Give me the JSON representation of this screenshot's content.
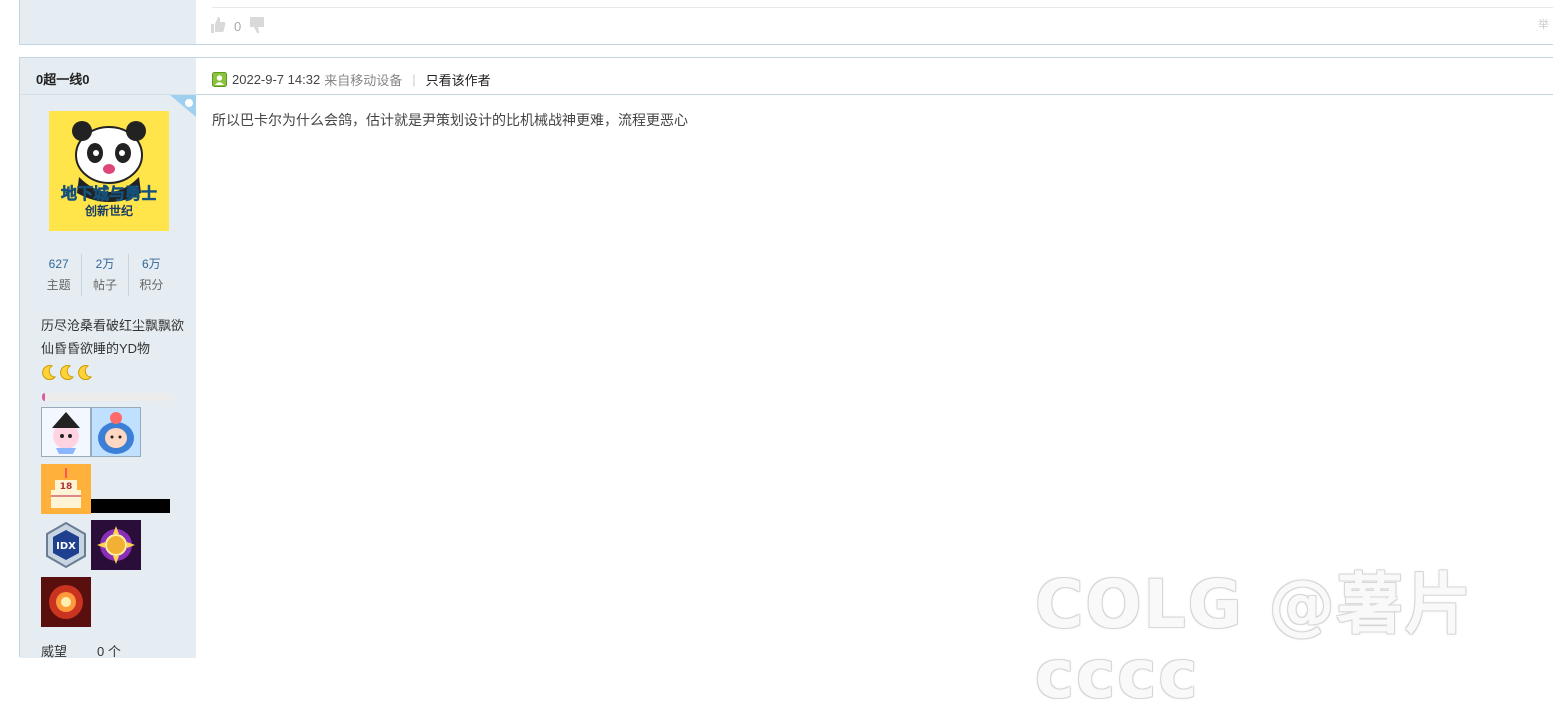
{
  "prev_post": {
    "vote_count": "0",
    "corner_text": "举"
  },
  "post": {
    "author": "0超一线0",
    "date": "2022-9-7 14:32",
    "source": "来自移动设备",
    "only_author_label": "只看该作者",
    "body": "所以巴卡尔为什么会鸽，估计就是尹策划设计的比机械战神更难，流程更恶心",
    "avatar": {
      "line1": "地下城与勇士",
      "line2": "创新世纪"
    },
    "stats": [
      {
        "value": "627",
        "label": "主题"
      },
      {
        "value": "2万",
        "label": "帖子"
      },
      {
        "value": "6万",
        "label": "积分"
      }
    ],
    "signature": "历尽沧桑看破红尘飘飘欲仙昏昏欲睡的YD物",
    "moons": [
      "☾",
      "☾",
      "☾"
    ],
    "progress_fraction": 0.015,
    "medal_badge_text": "IDX",
    "cake_text": "18",
    "bottom": {
      "label": "威望",
      "value": "0 个"
    }
  },
  "watermark": "COLG @薯片cccc",
  "colors": {
    "sidebar_bg": "#e5edf2",
    "border": "#c2d5e3",
    "link": "#336699"
  }
}
